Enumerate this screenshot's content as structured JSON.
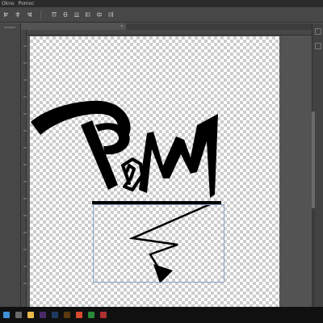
{
  "menubar": {
    "items": [
      "Okno",
      "Pomoc"
    ]
  },
  "options": {
    "label": ""
  },
  "document": {
    "tab_title": ""
  },
  "colors": {
    "app_bg": "#535353",
    "panel_bg": "#474747",
    "selection_border": "#88a5c8",
    "ink": "#000000",
    "taskbar_bg": "#101010"
  },
  "taskbar": {
    "icons": [
      "start-icon",
      "search-icon",
      "file-explorer-icon",
      "premiere-icon",
      "photoshop-icon",
      "illustrator-icon",
      "browser-icon",
      "media-icon",
      "music-icon"
    ]
  }
}
